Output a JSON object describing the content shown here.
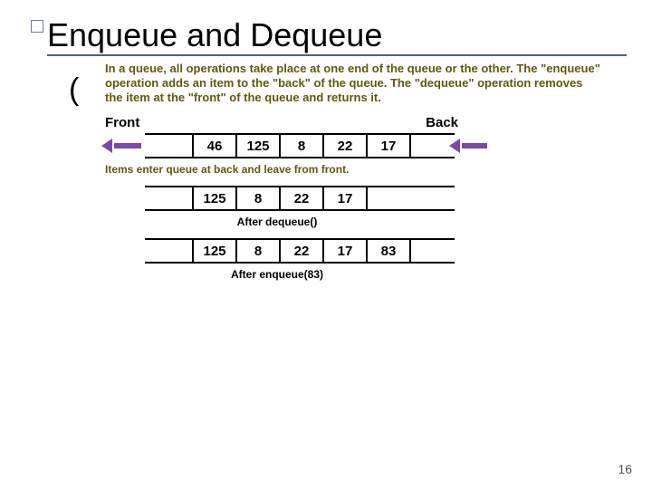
{
  "title": "Enqueue and Dequeue",
  "ghost_char": "(",
  "description": "In a queue, all operations take place at one end of the queue or the other.  The \"enqueue\" operation adds an item to the \"back\" of the queue.  The \"dequeue\" operation removes the item at the \"front\" of the queue and returns it.",
  "labels": {
    "front": "Front",
    "back": "Back"
  },
  "queue1": [
    "46",
    "125",
    "8",
    "22",
    "17"
  ],
  "caption1": "Items enter queue at back and leave from front.",
  "queue2": [
    "125",
    "8",
    "22",
    "17"
  ],
  "caption2": "After dequeue()",
  "queue3": [
    "125",
    "8",
    "22",
    "17",
    "83"
  ],
  "caption3": "After enqueue(83)",
  "page_number": "16"
}
